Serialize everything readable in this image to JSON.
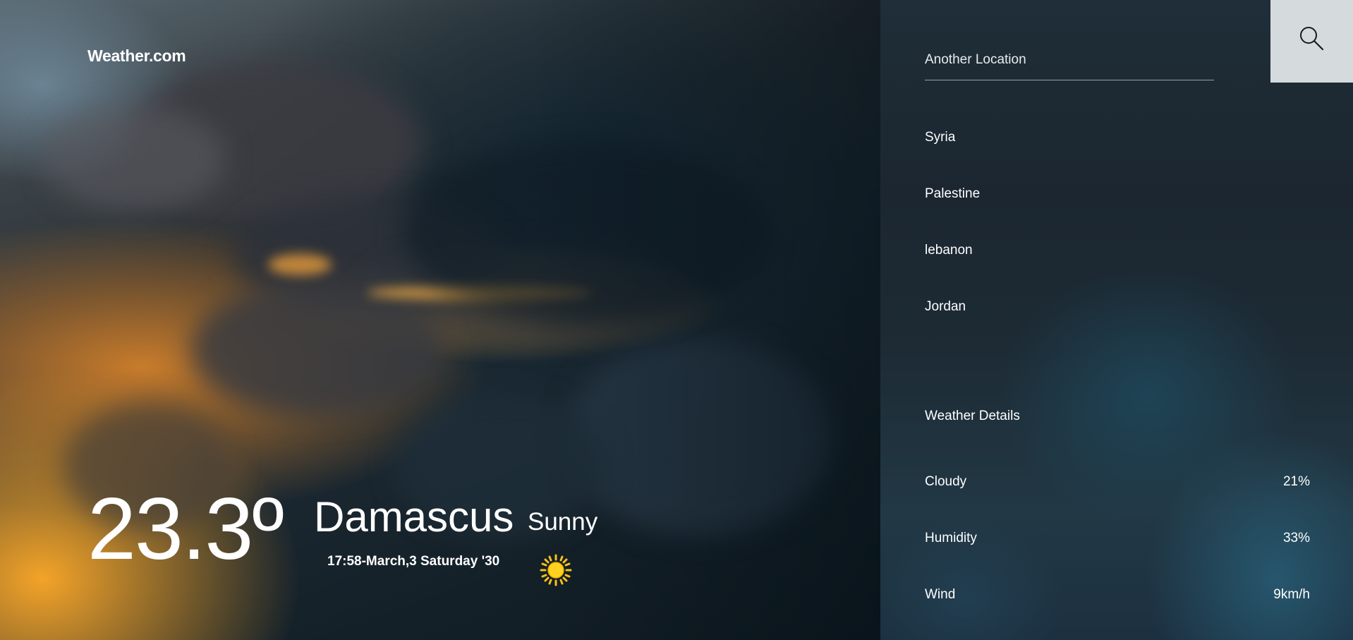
{
  "brand": {
    "title": "Weather.com"
  },
  "current": {
    "temperature": "23.3º",
    "city": "Damascus",
    "condition": "Sunny",
    "datetime": "17:58-March,3 Saturday '30",
    "icon": "sun-icon"
  },
  "search": {
    "placeholder": "Another Location",
    "button_icon": "search-icon"
  },
  "locations": [
    "Syria",
    "Palestine",
    "lebanon",
    "Jordan"
  ],
  "details": {
    "title": "Weather Details",
    "rows": [
      {
        "label": "Cloudy",
        "value": "21%"
      },
      {
        "label": "Humidity",
        "value": "33%"
      },
      {
        "label": "Wind",
        "value": "9km/h"
      }
    ]
  },
  "colors": {
    "search_button_bg": "#d5dadd",
    "text": "#ffffff",
    "sun": "#f7c21a"
  }
}
